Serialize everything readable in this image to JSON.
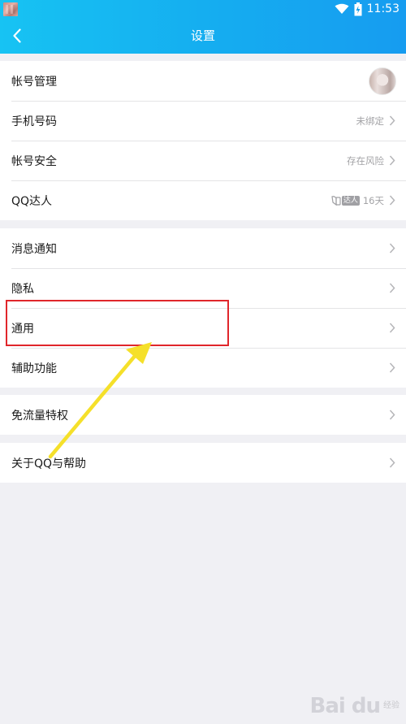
{
  "status_bar": {
    "time": "11:53",
    "icons": [
      "wifi-icon",
      "battery-icon"
    ]
  },
  "header": {
    "title": "设置",
    "back_icon": "back-icon"
  },
  "groups": [
    {
      "items": [
        {
          "label": "帐号管理",
          "value": "",
          "trailing": "avatar"
        },
        {
          "label": "手机号码",
          "value": "未绑定",
          "trailing": "chevron"
        },
        {
          "label": "帐号安全",
          "value": "存在风险",
          "trailing": "chevron"
        },
        {
          "label": "QQ达人",
          "badge_text": "达人",
          "value": "16天",
          "trailing": "chevron"
        }
      ]
    },
    {
      "items": [
        {
          "label": "消息通知",
          "value": "",
          "trailing": "chevron"
        },
        {
          "label": "隐私",
          "value": "",
          "trailing": "chevron"
        },
        {
          "label": "通用",
          "value": "",
          "trailing": "chevron"
        },
        {
          "label": "辅助功能",
          "value": "",
          "trailing": "chevron"
        }
      ]
    },
    {
      "items": [
        {
          "label": "免流量特权",
          "value": "",
          "trailing": "chevron"
        }
      ]
    },
    {
      "items": [
        {
          "label": "关于QQ与帮助",
          "value": "",
          "trailing": "chevron"
        }
      ]
    }
  ],
  "colors": {
    "header_gradient_start": "#17c3f3",
    "header_gradient_end": "#169cf0",
    "background": "#f0f0f4",
    "annotation_box": "#e0262b",
    "annotation_arrow": "#f5e02a"
  },
  "watermark": {
    "brand": "Bai du",
    "sub": "经验"
  }
}
